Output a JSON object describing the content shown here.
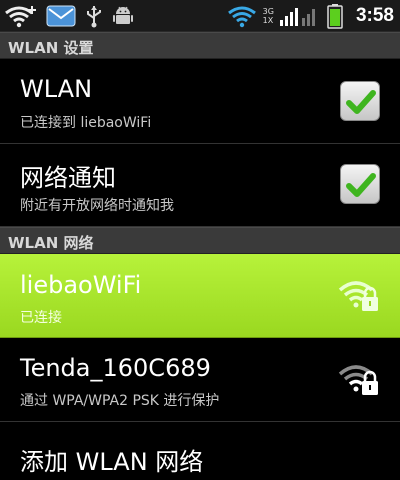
{
  "status_bar": {
    "time": "3:58",
    "net_top": "3G",
    "net_bottom": "1X",
    "icons": [
      "wifi-plus-icon",
      "mail-icon",
      "usb-icon",
      "android-debug-icon",
      "wifi-icon",
      "signal-icon",
      "battery-icon"
    ]
  },
  "sections": {
    "wlan_settings": "WLAN 设置",
    "wlan_networks": "WLAN 网络"
  },
  "settings": [
    {
      "title": "WLAN",
      "subtitle": "已连接到 liebaoWiFi",
      "checked": true
    },
    {
      "title": "网络通知",
      "subtitle": "附近有开放网络时通知我",
      "checked": true
    }
  ],
  "networks": [
    {
      "ssid": "liebaoWiFi",
      "status": "已连接",
      "secured": true,
      "selected": true
    },
    {
      "ssid": "Tenda_160C689",
      "status": "通过 WPA/WPA2 PSK 进行保护",
      "secured": true,
      "selected": false
    }
  ],
  "add_network": {
    "label": "添加 WLAN 网络"
  },
  "colors": {
    "selected_row": "#a8e82c",
    "check_green": "#3fb51f",
    "section_header": "#3a3a3a"
  }
}
